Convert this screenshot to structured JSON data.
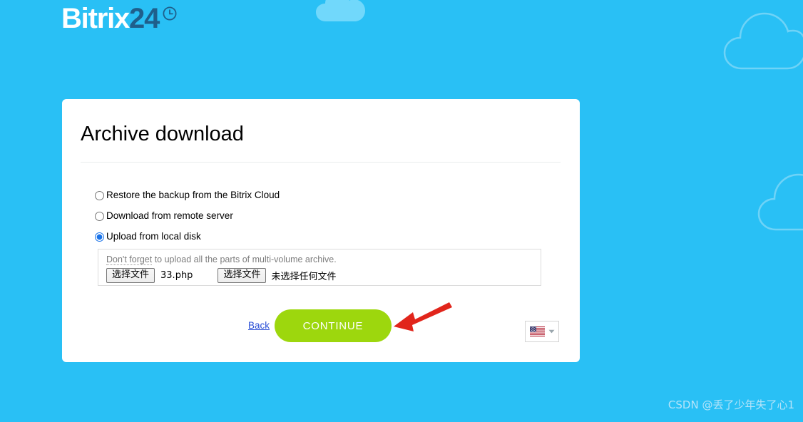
{
  "colors": {
    "background": "#29c0f5",
    "card": "#ffffff",
    "logo_primary": "#ffffff",
    "logo_accent": "#1f5f8b",
    "continue_button": "#9dd70d",
    "link": "#2a4fd6",
    "arrow": "#e1251b",
    "watermark": "#b5e4f9"
  },
  "brand": {
    "name_primary": "Bitrix",
    "name_accent": "24",
    "clock_icon": "clock-icon",
    "cloud_icon": "cloud-icon"
  },
  "card": {
    "title": "Archive download",
    "options": [
      {
        "label": "Restore the backup from the Bitrix Cloud",
        "selected": false
      },
      {
        "label": "Download from remote server",
        "selected": false
      },
      {
        "label": "Upload from local disk",
        "selected": true
      }
    ],
    "upload": {
      "hint_emphasis": "Don't forget",
      "hint_rest": " to upload all the parts of multi-volume archive.",
      "files": [
        {
          "button_label": "选择文件",
          "value": "33.php"
        },
        {
          "button_label": "选择文件",
          "value": "未选择任何文件"
        }
      ]
    },
    "actions": {
      "back_label": "Back",
      "continue_label": "CONTINUE"
    },
    "language": {
      "flag_icon": "us-flag-icon",
      "chevron_icon": "chevron-down-icon",
      "selected": "English"
    }
  },
  "annotation": {
    "arrow_icon": "red-arrow-icon",
    "points_to": "CONTINUE"
  },
  "watermark": {
    "text": "CSDN @丢了少年失了心1"
  }
}
